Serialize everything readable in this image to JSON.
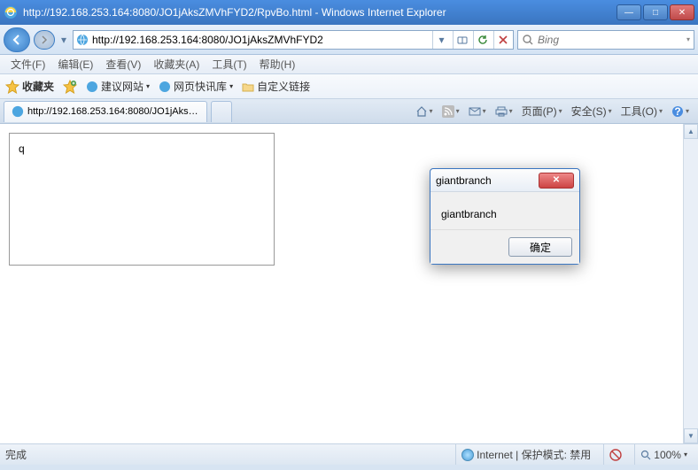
{
  "window": {
    "title": "http://192.168.253.164:8080/JO1jAksZMVhFYD2/RpvBo.html - Windows Internet Explorer"
  },
  "address": {
    "url": "http://192.168.253.164:8080/JO1jAksZMVhFYD2"
  },
  "search": {
    "placeholder": "Bing"
  },
  "menu": {
    "file": "文件(F)",
    "edit": "编辑(E)",
    "view": "查看(V)",
    "favorites": "收藏夹(A)",
    "tools": "工具(T)",
    "help": "帮助(H)"
  },
  "favbar": {
    "favorites": "收藏夹",
    "suggested": "建议网站",
    "slice": "网页快讯库",
    "custom": "自定义链接"
  },
  "tab": {
    "title": "http://192.168.253.164:8080/JO1jAksZMVhFY..."
  },
  "cmdbar": {
    "page": "页面(P)",
    "safety": "安全(S)",
    "tools": "工具(O)"
  },
  "page": {
    "textbox_value": "q"
  },
  "dialog": {
    "title": "giantbranch",
    "body": "giantbranch",
    "ok": "确定"
  },
  "status": {
    "done": "完成",
    "zone": "Internet | 保护模式: 禁用",
    "zoom": "100%"
  }
}
